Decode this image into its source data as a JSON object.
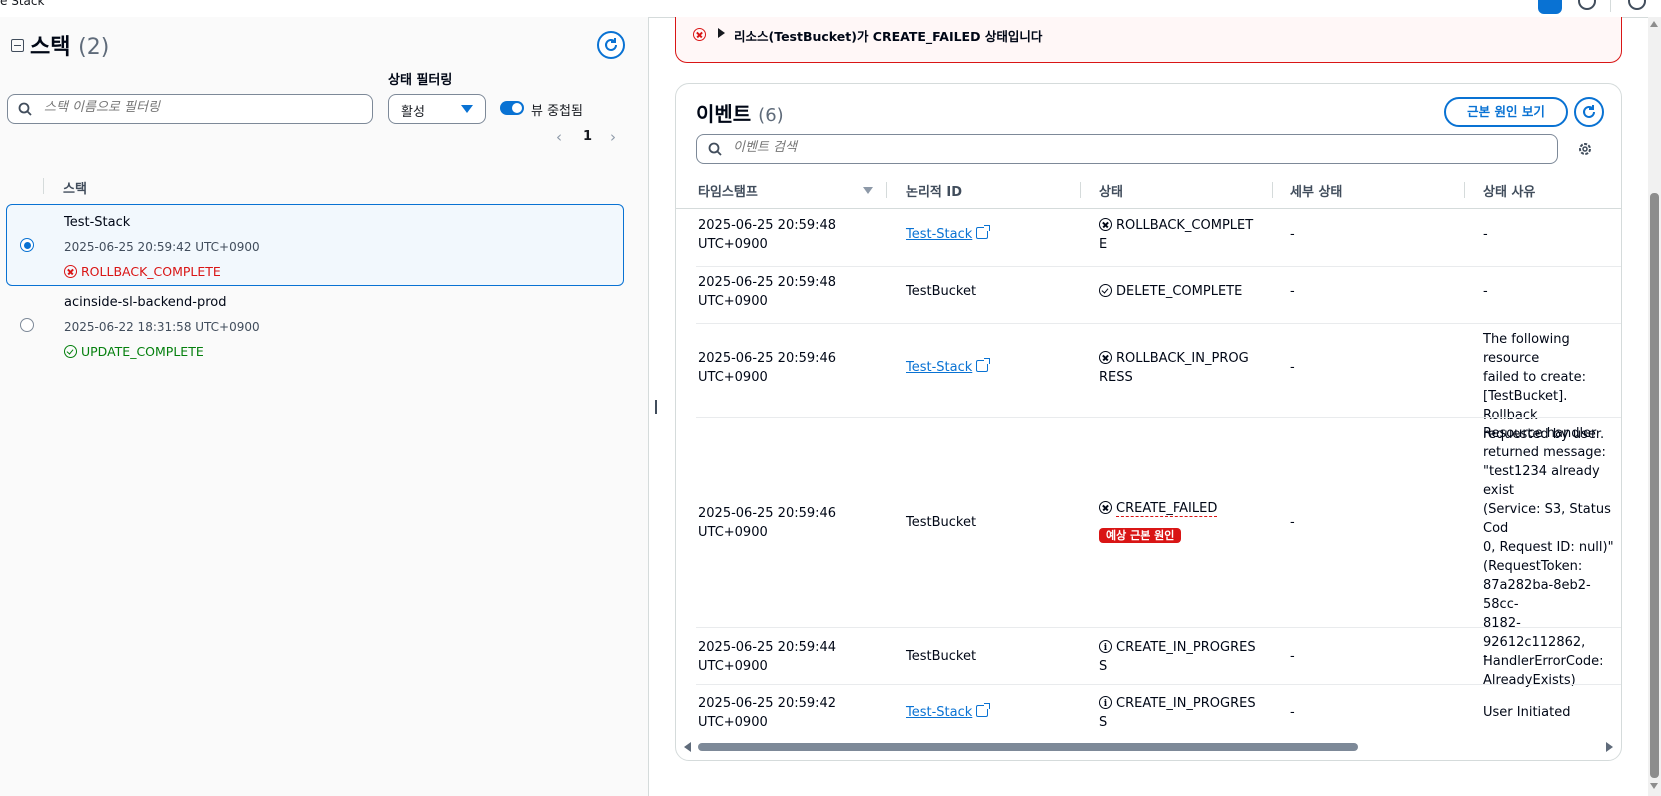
{
  "topbar": {
    "breadcrumb": "e Stack"
  },
  "left": {
    "title": "스택",
    "count": "(2)",
    "status_filter_label": "상태 필터링",
    "search_placeholder": "스택 이름으로 필터링",
    "status_filter_value": "활성",
    "nested_toggle_label": "뷰 중첩됨",
    "page": "1",
    "column_header": "스택",
    "stacks": [
      {
        "name": "Test-Stack",
        "time": "2025-06-25 20:59:42 UTC+0900",
        "status": "ROLLBACK_COMPLETE",
        "selected": true
      },
      {
        "name": "acinside-sl-backend-prod",
        "time": "2025-06-22 18:31:58 UTC+0900",
        "status": "UPDATE_COMPLETE",
        "selected": false
      }
    ]
  },
  "alert": {
    "message": "리소스(TestBucket)가 CREATE_FAILED 상태입니다"
  },
  "events": {
    "title": "이벤트",
    "count": "(6)",
    "root_cause_button": "근본 원인 보기",
    "search_placeholder": "이벤트 검색",
    "columns": [
      "타임스탬프",
      "논리적 ID",
      "상태",
      "세부 상태",
      "상태 사유"
    ],
    "rows": [
      {
        "ts1": "2025-06-25 20:59:48",
        "ts2": "UTC+0900",
        "logical_id": "Test-Stack",
        "status1": "ROLLBACK_COMPLET",
        "status2": "E",
        "detail": "-",
        "reason": [
          "-"
        ]
      },
      {
        "ts1": "2025-06-25 20:59:48",
        "ts2": "UTC+0900",
        "logical_id": "TestBucket",
        "status1": "DELETE_COMPLETE",
        "status2": "",
        "detail": "-",
        "reason": [
          "-"
        ]
      },
      {
        "ts1": "2025-06-25 20:59:46",
        "ts2": "UTC+0900",
        "logical_id": "Test-Stack",
        "status1": "ROLLBACK_IN_PROG",
        "status2": "RESS",
        "detail": "-",
        "reason": [
          "The following resource",
          "failed to create:",
          "[TestBucket]. Rollback",
          "requested by user."
        ]
      },
      {
        "ts1": "2025-06-25 20:59:46",
        "ts2": "UTC+0900",
        "logical_id": "TestBucket",
        "status1": "CREATE_FAILED",
        "status2": "",
        "badge": "예상 근본 원인",
        "detail": "-",
        "reason": [
          "Resource handler",
          "returned message:",
          "\"test1234 already exist",
          "(Service: S3, Status Cod",
          "0, Request ID: null)\"",
          "(RequestToken:",
          "87a282ba-8eb2-58cc-",
          "8182-92612c112862,",
          "HandlerErrorCode:",
          "AlreadyExists)"
        ]
      },
      {
        "ts1": "2025-06-25 20:59:44",
        "ts2": "UTC+0900",
        "logical_id": "TestBucket",
        "status1": "CREATE_IN_PROGRES",
        "status2": "S",
        "detail": "-",
        "reason": [
          "-"
        ]
      },
      {
        "ts1": "2025-06-25 20:59:42",
        "ts2": "UTC+0900",
        "logical_id": "Test-Stack",
        "status1": "CREATE_IN_PROGRES",
        "status2": "S",
        "detail": "-",
        "reason": [
          "User Initiated"
        ]
      }
    ]
  },
  "colors": {
    "error": "#d91515",
    "success": "#037f0c",
    "info": "#0972d3",
    "accent": "#0972d3"
  },
  "icons": [
    "search-icon",
    "refresh-icon",
    "gear-icon",
    "external-link-icon",
    "error-icon",
    "success-icon",
    "info-icon"
  ]
}
